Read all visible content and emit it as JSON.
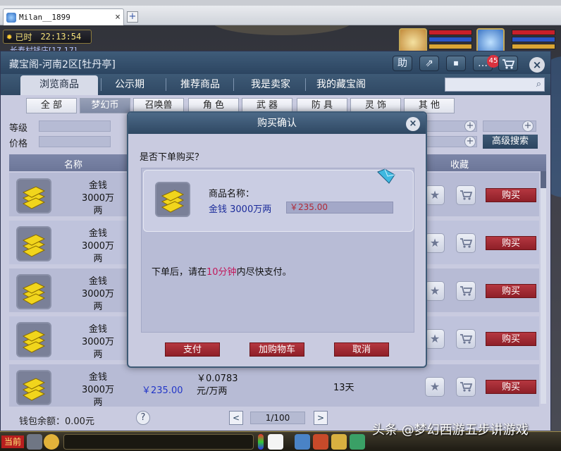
{
  "browser": {
    "tab_title": "Milan__1899",
    "tab_close": "×",
    "add_tab": "+"
  },
  "hud": {
    "time_label": "已时",
    "time": "22:13:54",
    "location": "长寿村钱庄[17,17]"
  },
  "store": {
    "title": "藏宝阁-河南2区[牡丹亭]",
    "header_buttons": [
      "助",
      "⇗",
      "⏹",
      "…"
    ],
    "message_badge": "45",
    "close": "×",
    "nav_tabs": [
      "浏览商品",
      "公示期",
      "推荐商品",
      "我是卖家",
      "我的藏宝阁"
    ],
    "active_nav": 0,
    "categories": [
      "全 部",
      "梦幻币",
      "召唤兽",
      "角 色",
      "武 器",
      "防 具",
      "灵 饰",
      "其 他"
    ],
    "active_category": 1,
    "filters": {
      "level_label": "等级",
      "price_label": "价格"
    },
    "advanced_search": "高级搜索",
    "table_headers": {
      "name": "名称",
      "favorite": "收藏"
    },
    "rows": [
      {
        "name": "金钱",
        "amount": "3000万两",
        "price": "",
        "unit_price": "",
        "unit": "",
        "days": ""
      },
      {
        "name": "金钱",
        "amount": "3000万两",
        "price": "",
        "unit_price": "",
        "unit": "",
        "days": ""
      },
      {
        "name": "金钱",
        "amount": "3000万两",
        "price": "",
        "unit_price": "",
        "unit": "",
        "days": ""
      },
      {
        "name": "金钱",
        "amount": "3000万两",
        "price": "",
        "unit_price": "",
        "unit": "",
        "days": ""
      },
      {
        "name": "金钱",
        "amount": "3000万两",
        "price": "￥235.00",
        "unit_price": "￥0.0783",
        "unit": "元/万两",
        "days": "13天"
      }
    ],
    "buy_label": "购买",
    "star_icon": "★",
    "cart_icon": "🛒",
    "footer": {
      "wallet": "钱包余额：0.00元",
      "help": "?",
      "prev": "<",
      "page": "1/100",
      "next": ">"
    }
  },
  "modal": {
    "title": "购买确认",
    "close": "×",
    "question": "是否下单购买？",
    "item_label": "商品名称：",
    "item_name": "金钱 3000万两",
    "price": "￥235.00",
    "notice_pre": "下单后，请在",
    "notice_highlight": "10分钟",
    "notice_post": "内尽快支付。",
    "buttons": {
      "pay": "支付",
      "add_cart": "加购物车",
      "cancel": "取消"
    }
  },
  "bottom": {
    "channel": "当前"
  },
  "watermark": "头条 @梦幻西游五步讲游戏",
  "colors": {
    "header_blue": "#2f4863",
    "buy_red": "#a02a33",
    "price_blue": "#2236c8",
    "highlight_pink": "#c2185b"
  }
}
